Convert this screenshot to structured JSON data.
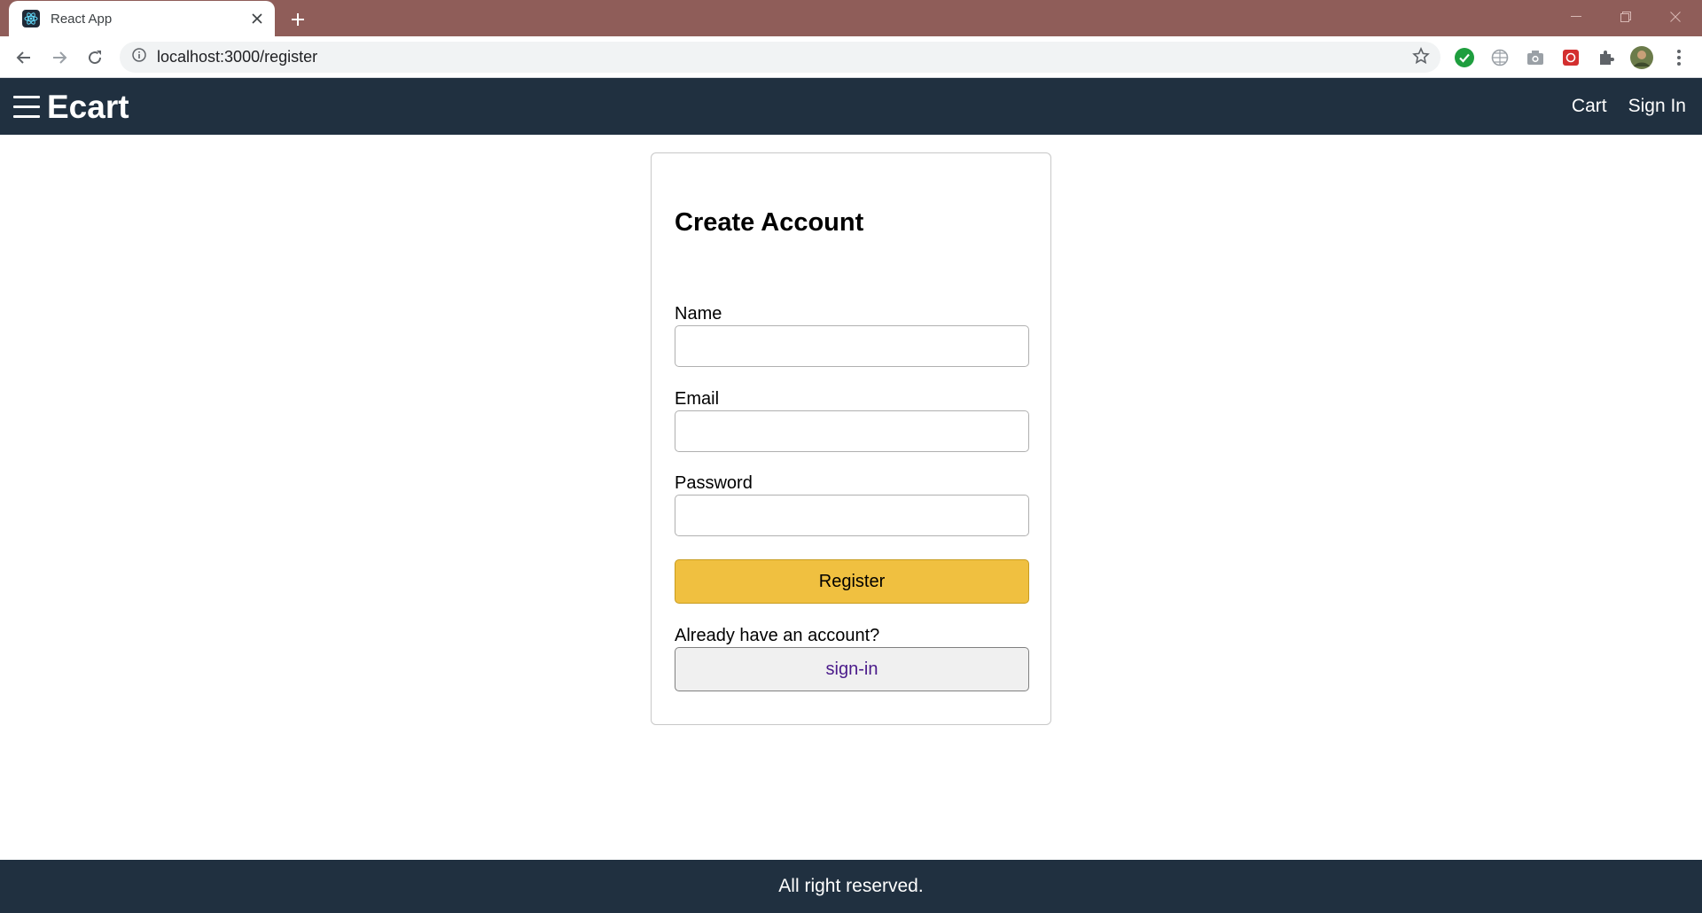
{
  "browser": {
    "tab_title": "React App",
    "url": "localhost:3000/register",
    "icons": {
      "favicon": "react-icon",
      "tab_close": "close-icon",
      "new_tab": "plus-icon",
      "back": "arrow-left-icon",
      "forward": "arrow-right-icon",
      "reload": "reload-icon",
      "site_info": "info-icon",
      "bookmark": "star-icon",
      "extensions": [
        "check-circle-icon",
        "globe-icon",
        "camera-icon",
        "red-extension-icon",
        "puzzle-icon"
      ],
      "profile": "avatar",
      "menu": "kebab-menu-icon"
    }
  },
  "header": {
    "brand": "Ecart",
    "links": {
      "cart": "Cart",
      "sign_in": "Sign In"
    }
  },
  "form": {
    "title": "Create Account",
    "name_label": "Name",
    "name_value": "",
    "email_label": "Email",
    "email_value": "",
    "password_label": "Password",
    "password_value": "",
    "register_label": "Register",
    "prompt_text": "Already have an account?",
    "signin_label": "sign-in"
  },
  "footer": {
    "text": "All right reserved."
  },
  "colors": {
    "tabstrip": "#8f5d59",
    "header_bg": "#203040",
    "register_button": "#f0c040",
    "signin_button": "#f0f0f0",
    "signin_text": "#4a1a8a"
  }
}
